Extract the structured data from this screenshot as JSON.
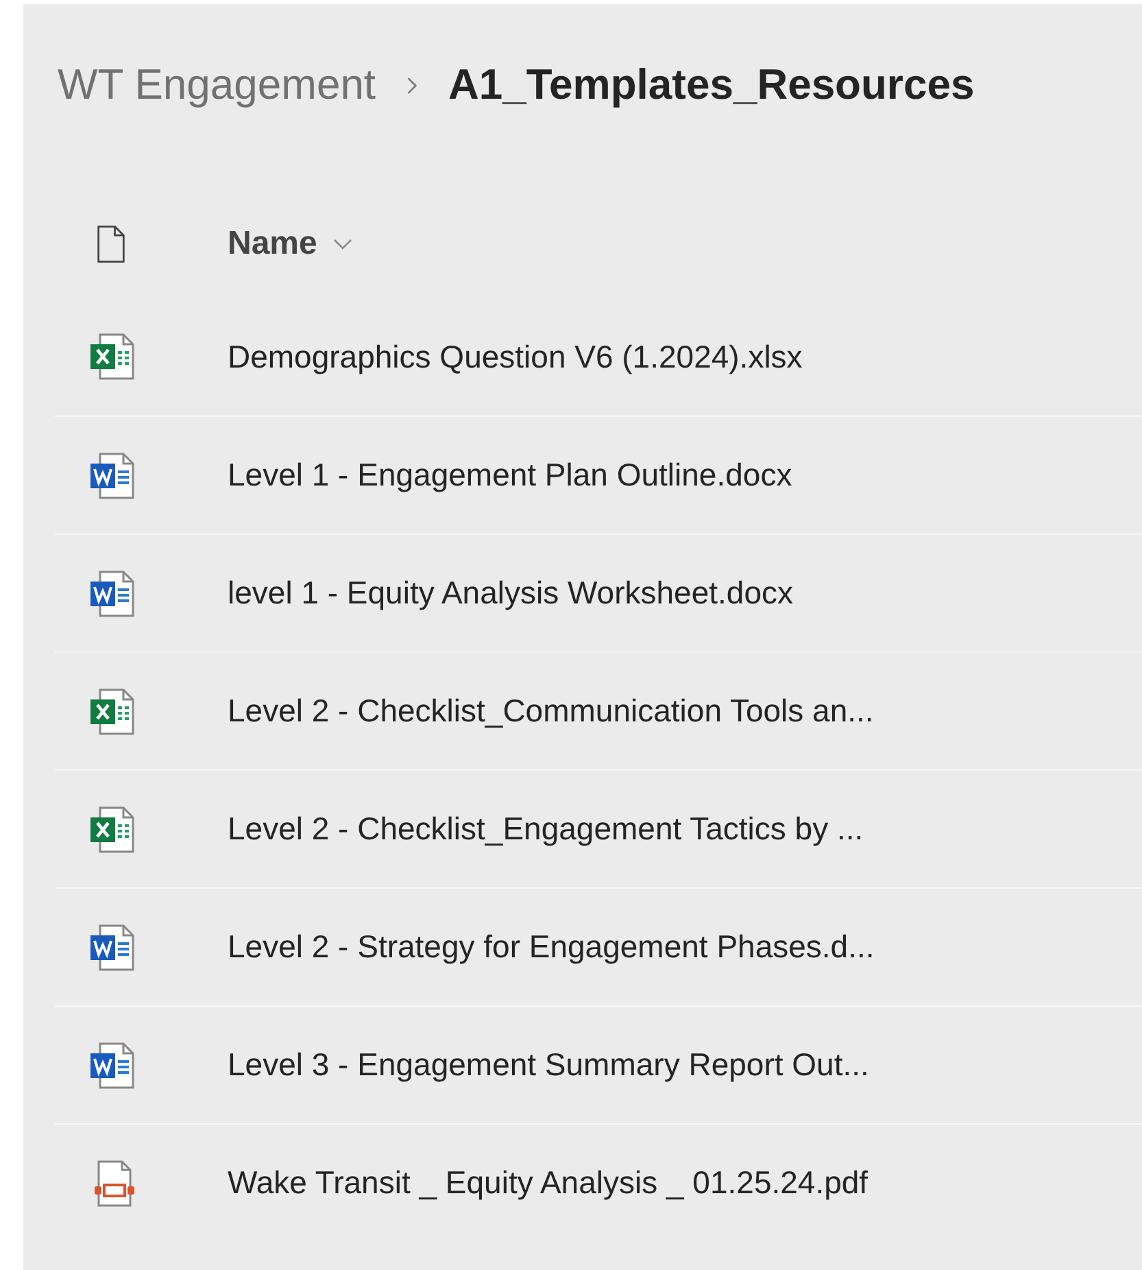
{
  "breadcrumb": [
    {
      "label": "WT Engagement",
      "current": false
    },
    {
      "label": "A1_Templates_Resources",
      "current": true
    }
  ],
  "table": {
    "columns": [
      {
        "label": "Name"
      }
    ],
    "rows": [
      {
        "kind": "excel",
        "name": "Demographics Question V6 (1.2024).xlsx"
      },
      {
        "kind": "word",
        "name": "Level 1 - Engagement Plan Outline.docx"
      },
      {
        "kind": "word",
        "name": "level 1 - Equity Analysis Worksheet.docx"
      },
      {
        "kind": "excel",
        "name": "Level 2 - Checklist_Communication Tools an..."
      },
      {
        "kind": "excel",
        "name": "Level 2 - Checklist_Engagement Tactics by ..."
      },
      {
        "kind": "word",
        "name": "Level 2 - Strategy for Engagement Phases.d..."
      },
      {
        "kind": "word",
        "name": "Level 3 - Engagement Summary Report Out..."
      },
      {
        "kind": "pdf",
        "name": "Wake Transit _ Equity Analysis _ 01.25.24.pdf"
      }
    ]
  }
}
